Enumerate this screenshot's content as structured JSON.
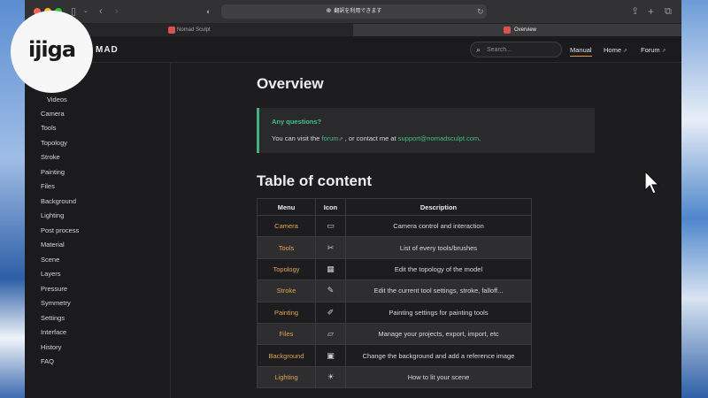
{
  "browser": {
    "address_text": "翻訳を利用できます",
    "tabs": [
      {
        "label": "Nomad Sculpt"
      },
      {
        "label": "Overview"
      }
    ]
  },
  "watermark": {
    "text": "ijiga"
  },
  "site": {
    "brand": "MAD",
    "search_placeholder": "Search...",
    "nav": [
      {
        "label": "Manual"
      },
      {
        "label": "Home"
      },
      {
        "label": "Forum"
      }
    ]
  },
  "sidebar": {
    "items": [
      {
        "label": "Videos"
      },
      {
        "label": "Camera"
      },
      {
        "label": "Tools"
      },
      {
        "label": "Topology"
      },
      {
        "label": "Stroke"
      },
      {
        "label": "Painting"
      },
      {
        "label": "Files"
      },
      {
        "label": "Background"
      },
      {
        "label": "Lighting"
      },
      {
        "label": "Post process"
      },
      {
        "label": "Material"
      },
      {
        "label": "Scene"
      },
      {
        "label": "Layers"
      },
      {
        "label": "Pressure"
      },
      {
        "label": "Symmetry"
      },
      {
        "label": "Settings"
      },
      {
        "label": "Interface"
      },
      {
        "label": "History"
      },
      {
        "label": "FAQ"
      }
    ]
  },
  "main": {
    "title": "Overview",
    "callout": {
      "heading": "Any questions?",
      "text_before": "You can visit the ",
      "forum_link": "forum",
      "text_middle": " , or contact me at ",
      "email": "support@nomadsculpt.com",
      "text_after": "."
    },
    "toc_title": "Table of content",
    "table": {
      "headers": [
        "Menu",
        "Icon",
        "Description"
      ],
      "rows": [
        {
          "menu": "Camera",
          "icon": "camera-icon",
          "glyph": "▭",
          "description": "Camera control and interaction"
        },
        {
          "menu": "Tools",
          "icon": "tools-icon",
          "glyph": "✂",
          "description": "List of every tools/brushes"
        },
        {
          "menu": "Topology",
          "icon": "grid-icon",
          "glyph": "▦",
          "description": "Edit the topology of the model"
        },
        {
          "menu": "Stroke",
          "icon": "pencil-icon",
          "glyph": "✎",
          "description": "Edit the current tool settings, stroke, falloff..."
        },
        {
          "menu": "Painting",
          "icon": "brush-icon",
          "glyph": "✐",
          "description": "Painting settings for painting tools"
        },
        {
          "menu": "Files",
          "icon": "folder-icon",
          "glyph": "▱",
          "description": "Manage your projects, export, import, etc"
        },
        {
          "menu": "Background",
          "icon": "image-icon",
          "glyph": "▣",
          "description": "Change the background and add a reference image"
        },
        {
          "menu": "Lighting",
          "icon": "sun-icon",
          "glyph": "☀",
          "description": "How to lit your scene"
        }
      ]
    }
  },
  "colors": {
    "accent_green": "#43bf86",
    "menu_orange": "#e0a44e",
    "active_underline": "#e59a3a"
  }
}
